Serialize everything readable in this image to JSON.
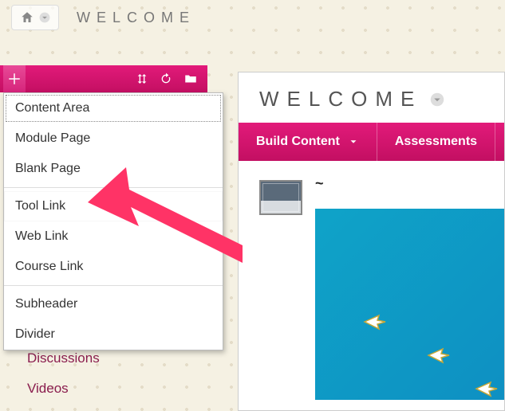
{
  "breadcrumb": {
    "title": "WELCOME"
  },
  "dropdown": {
    "groups": [
      [
        "Content Area",
        "Module Page",
        "Blank Page"
      ],
      [
        "Tool Link",
        "Web Link",
        "Course Link"
      ],
      [
        "Subheader",
        "Divider"
      ]
    ],
    "highlighted": "Tool Link"
  },
  "sidebar_links": [
    "Discussions",
    "Videos"
  ],
  "content": {
    "title": "WELCOME",
    "tabs": [
      "Build Content",
      "Assessments"
    ],
    "item_title": "~"
  },
  "colors": {
    "brand_pink": "#d6247b",
    "link_maroon": "#8a1d4e",
    "anno_pink": "#ff3366"
  }
}
